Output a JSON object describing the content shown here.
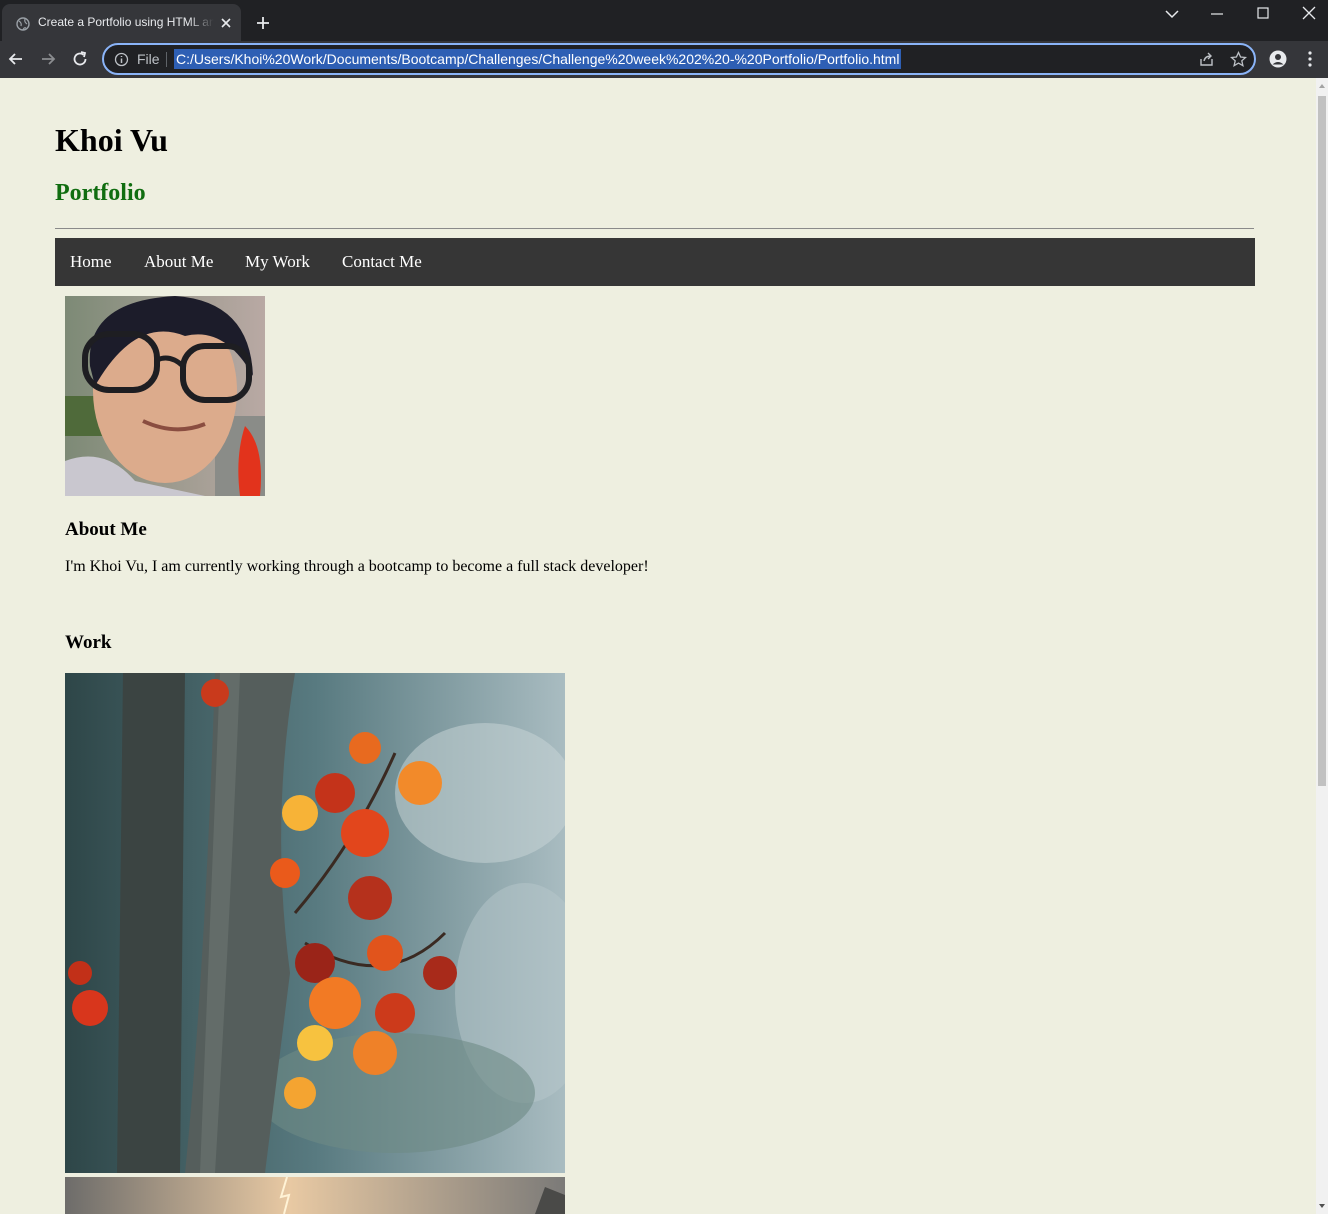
{
  "browser": {
    "tab_title": "Create a Portfolio using HTML and CSS",
    "omnibox_scheme_label": "File",
    "url": "C:/Users/Khoi%20Work/Documents/Bootcamp/Challenges/Challenge%20week%202%20-%20Portfolio/Portfolio.html"
  },
  "page": {
    "header": {
      "name": "Khoi Vu",
      "subtitle": "Portfolio"
    },
    "nav": [
      {
        "label": "Home"
      },
      {
        "label": "About Me"
      },
      {
        "label": "My Work"
      },
      {
        "label": "Contact Me"
      }
    ],
    "about": {
      "heading": "About Me",
      "text": "I'm Khoi Vu, I am currently working through a bootcamp to become a full stack developer!"
    },
    "work": {
      "heading": "Work"
    }
  },
  "colors": {
    "page_background": "#eeefe0",
    "subtitle_green": "#106d10",
    "nav_background": "#363636",
    "omnibox_focus": "#8ab4f8"
  }
}
